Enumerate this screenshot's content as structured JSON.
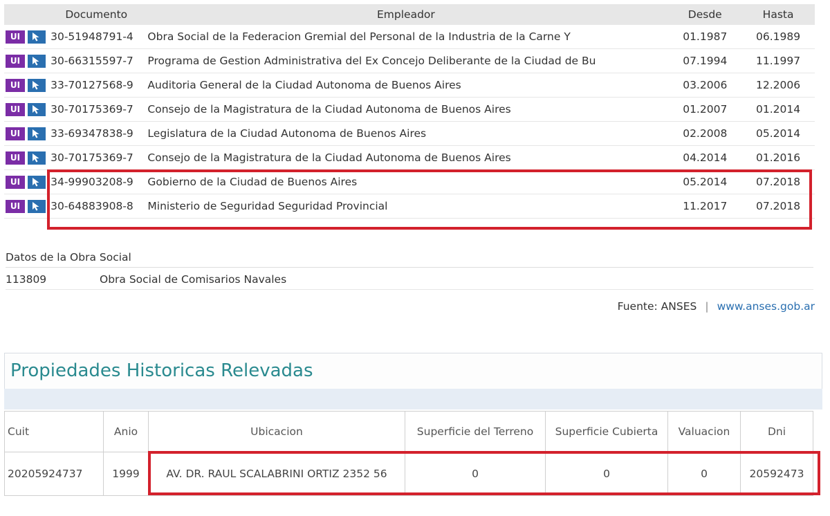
{
  "employment": {
    "headers": {
      "documento": "Documento",
      "empleador": "Empleador",
      "desde": "Desde",
      "hasta": "Hasta"
    },
    "badge_ui": "UI",
    "rows": [
      {
        "documento": "30-51948791-4",
        "empleador": "Obra Social de la Federacion Gremial del Personal de la Industria de la Carne Y",
        "desde": "01.1987",
        "hasta": "06.1989"
      },
      {
        "documento": "30-66315597-7",
        "empleador": "Programa de Gestion Administrativa del Ex Concejo Deliberante de la Ciudad de Bu",
        "desde": "07.1994",
        "hasta": "11.1997"
      },
      {
        "documento": "33-70127568-9",
        "empleador": "Auditoria General de la Ciudad Autonoma de Buenos Aires",
        "desde": "03.2006",
        "hasta": "12.2006"
      },
      {
        "documento": "30-70175369-7",
        "empleador": "Consejo de la Magistratura de la Ciudad Autonoma de Buenos Aires",
        "desde": "01.2007",
        "hasta": "01.2014"
      },
      {
        "documento": "33-69347838-9",
        "empleador": "Legislatura de la Ciudad Autonoma de Buenos Aires",
        "desde": "02.2008",
        "hasta": "05.2014"
      },
      {
        "documento": "30-70175369-7",
        "empleador": "Consejo de la Magistratura de la Ciudad Autonoma de Buenos Aires",
        "desde": "04.2014",
        "hasta": "01.2016"
      },
      {
        "documento": "34-99903208-9",
        "empleador": "Gobierno de la Ciudad de Buenos Aires",
        "desde": "05.2014",
        "hasta": "07.2018"
      },
      {
        "documento": "30-64883908-8",
        "empleador": "Ministerio de Seguridad Seguridad Provincial",
        "desde": "11.2017",
        "hasta": "07.2018"
      }
    ]
  },
  "obra_social": {
    "title": "Datos de la Obra Social",
    "code": "113809",
    "name": "Obra Social de Comisarios Navales"
  },
  "fuente": {
    "label": "Fuente: ANSES",
    "separator": "|",
    "link": "www.anses.gob.ar"
  },
  "propiedades": {
    "title": "Propiedades Historicas Relevadas",
    "headers": {
      "cuit": "Cuit",
      "anio": "Anio",
      "ubicacion": "Ubicacion",
      "sup_terreno": "Superficie del Terreno",
      "sup_cubierta": "Superficie Cubierta",
      "valuacion": "Valuacion",
      "dni": "Dni"
    },
    "row": {
      "cuit": "20205924737",
      "anio": "1999",
      "ubicacion": "AV. DR. RAUL SCALABRINI ORTIZ 2352 56",
      "sup_terreno": "0",
      "sup_cubierta": "0",
      "valuacion": "0",
      "dni": "20592473"
    }
  },
  "colors": {
    "highlight": "#d3212c",
    "ui_badge": "#7b2da6",
    "cursor_badge": "#2a6fb0",
    "title_teal": "#2a8a8f",
    "link": "#2a6fb0"
  }
}
